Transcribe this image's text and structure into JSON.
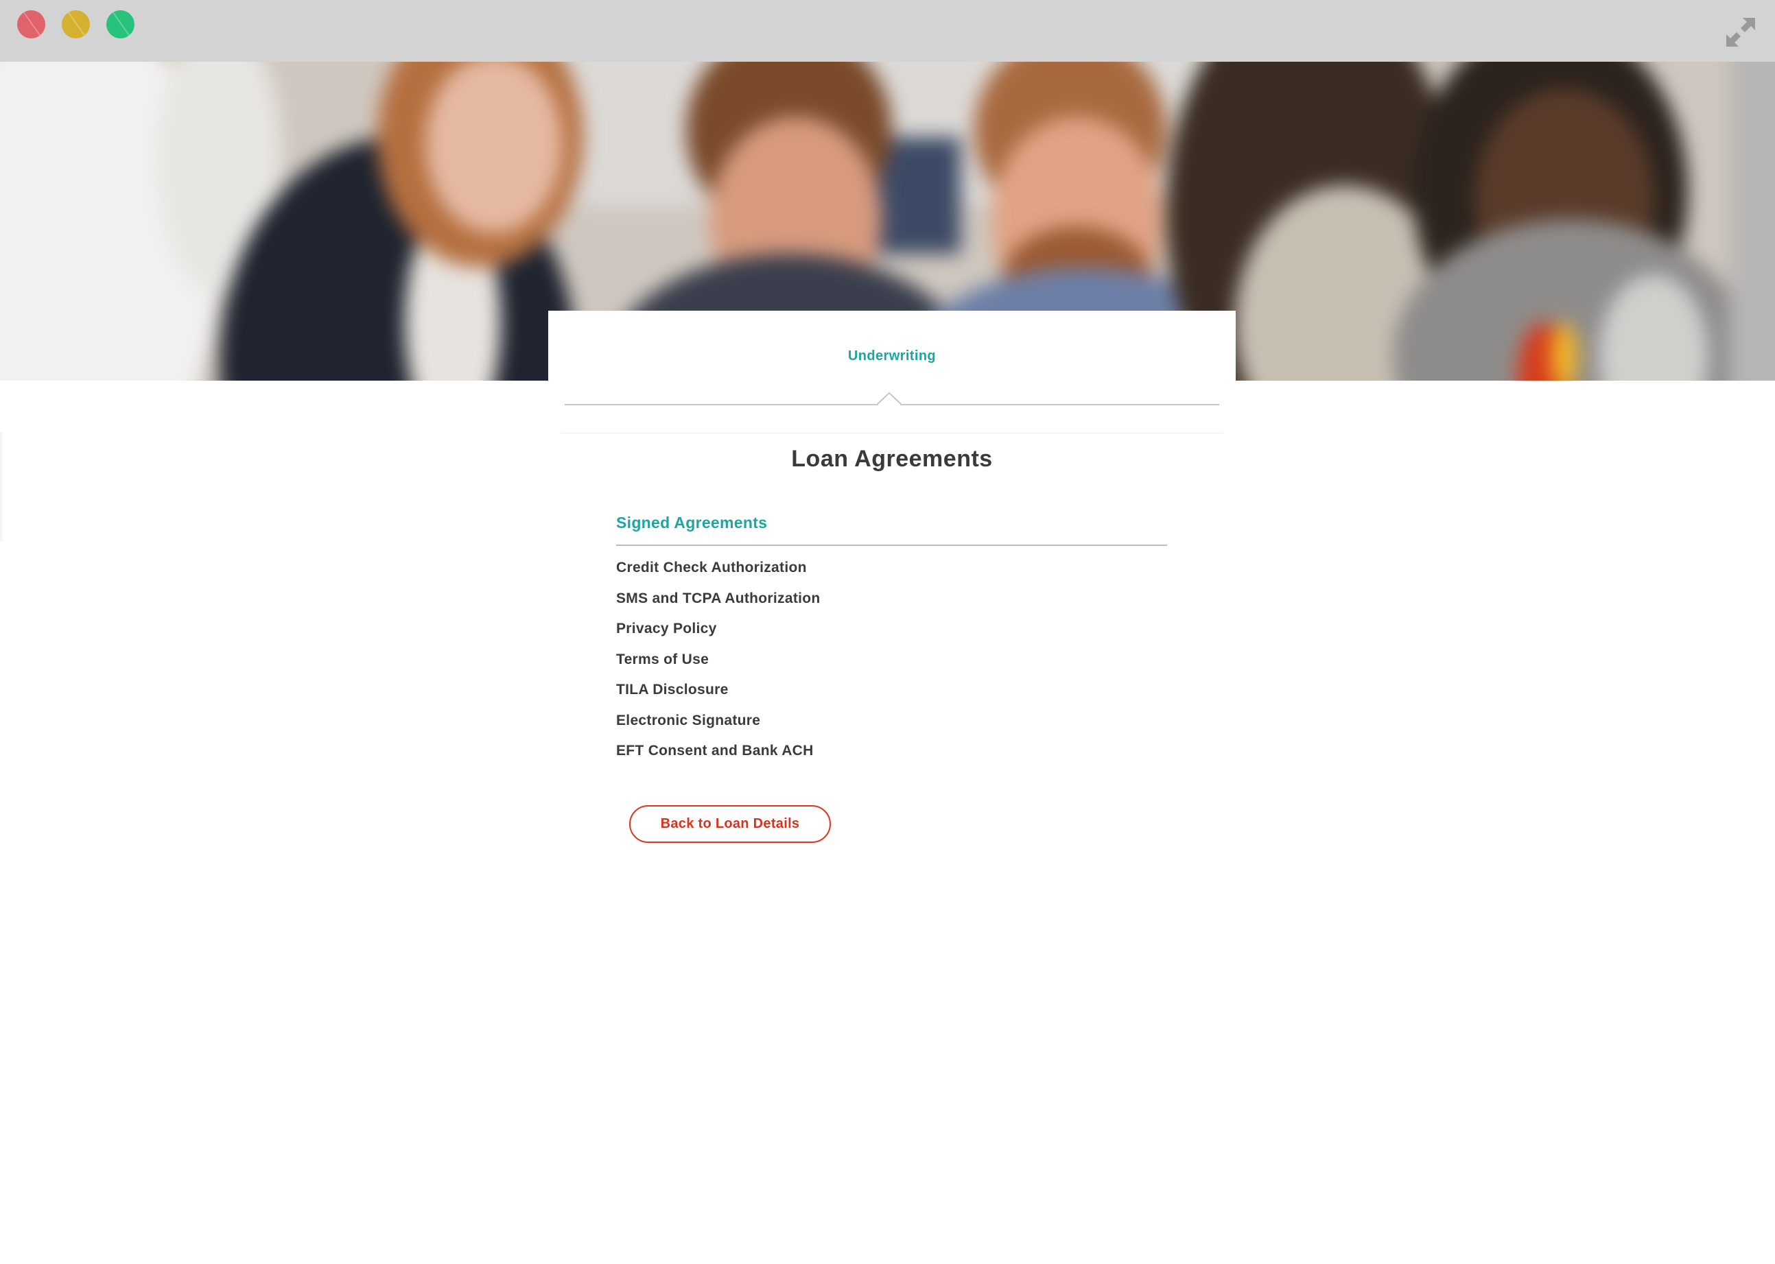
{
  "window": {
    "controls": [
      "close",
      "minimize",
      "maximize"
    ],
    "expand_icon": "expand-arrows-icon"
  },
  "hero": {
    "image": "blurred-office-team-photo"
  },
  "tabs": {
    "active_label": "Underwriting"
  },
  "main": {
    "title": "Loan Agreements",
    "section_heading": "Signed Agreements",
    "agreements": [
      "Credit Check Authorization",
      "SMS and TCPA Authorization",
      "Privacy Policy",
      "Terms of Use",
      "TILA Disclosure",
      "Electronic Signature",
      "EFT Consent and Bank ACH"
    ],
    "back_button_label": "Back to Loan Details"
  },
  "colors": {
    "accent_teal": "#1aa7a0",
    "action_red": "#e0351f",
    "text_dark": "#3a3a3a",
    "titlebar_gray": "#d3d3d3"
  }
}
